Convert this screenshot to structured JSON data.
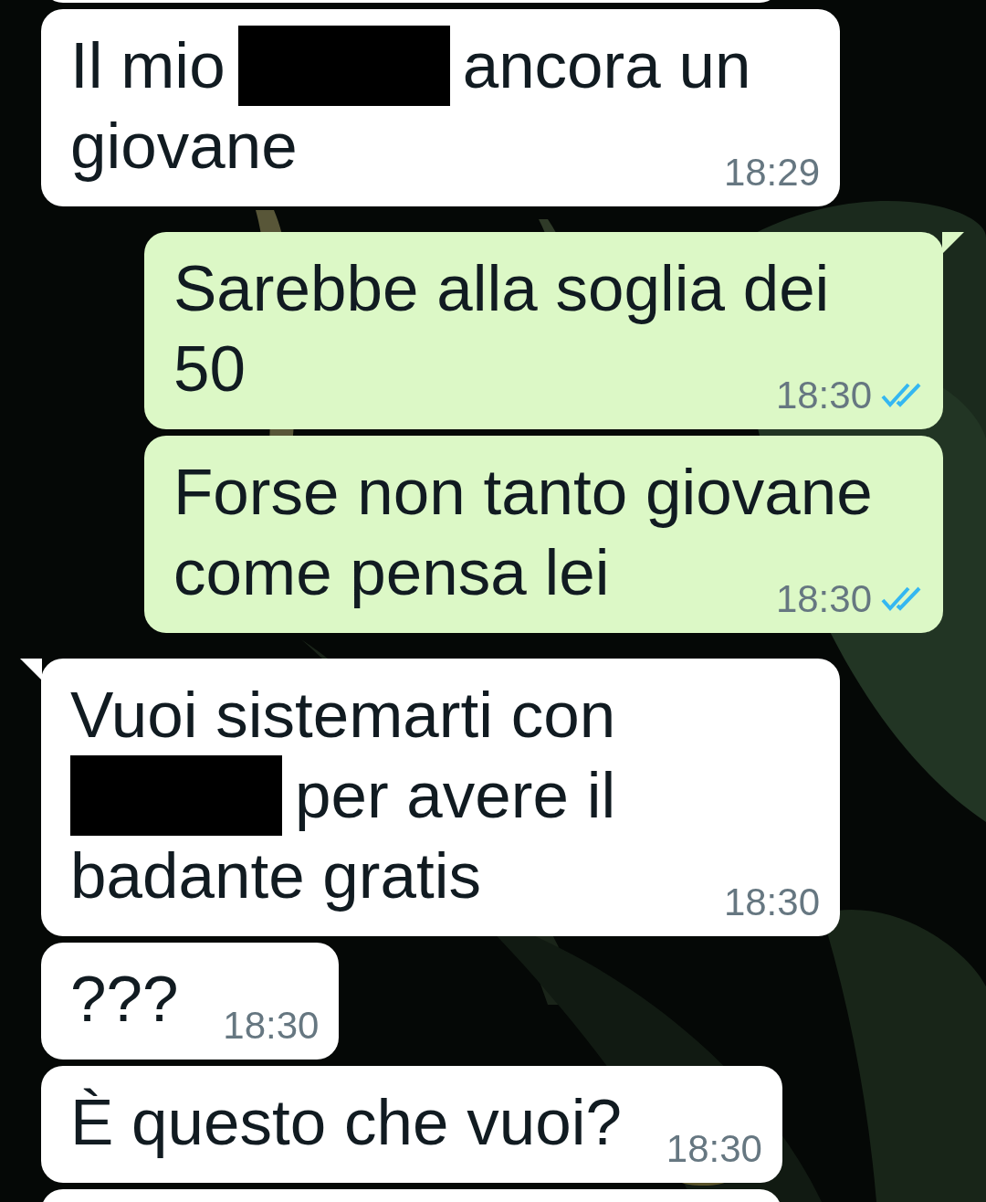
{
  "messages": [
    {
      "kind": "cut",
      "outgoing": false
    },
    {
      "kind": "message",
      "outgoing": false,
      "tail": false,
      "lines": [
        [
          {
            "kind": "text",
            "text": "Il mio"
          },
          {
            "kind": "redaction"
          },
          {
            "kind": "text",
            "text": "ancora un"
          }
        ],
        [
          {
            "kind": "text",
            "text": "giovane"
          }
        ]
      ],
      "time": "18:29"
    },
    {
      "kind": "message",
      "outgoing": true,
      "tail": true,
      "lines": [
        [
          {
            "kind": "text",
            "text": "Sarebbe alla soglia dei"
          }
        ],
        [
          {
            "kind": "text",
            "text": "50"
          }
        ]
      ],
      "time": "18:30",
      "read": true
    },
    {
      "kind": "message",
      "outgoing": true,
      "tail": false,
      "lines": [
        [
          {
            "kind": "text",
            "text": "Forse non tanto giovane"
          }
        ],
        [
          {
            "kind": "text",
            "text": "come pensa lei"
          }
        ]
      ],
      "time": "18:30",
      "read": true
    },
    {
      "kind": "message",
      "outgoing": false,
      "tail": true,
      "lines": [
        [
          {
            "kind": "text",
            "text": "Vuoi sistemarti con"
          }
        ],
        [
          {
            "kind": "redaction"
          },
          {
            "kind": "text",
            "text": "per avere il"
          }
        ],
        [
          {
            "kind": "text",
            "text": "badante gratis"
          }
        ]
      ],
      "time": "18:30"
    },
    {
      "kind": "message",
      "outgoing": false,
      "tail": false,
      "lines": [
        [
          {
            "kind": "text",
            "text": "???"
          }
        ]
      ],
      "time": "18:30"
    },
    {
      "kind": "message",
      "outgoing": false,
      "tail": false,
      "lines": [
        [
          {
            "kind": "text",
            "text": "È questo che vuoi?"
          }
        ]
      ],
      "time": "18:30"
    },
    {
      "kind": "cut",
      "outgoing": false
    }
  ]
}
